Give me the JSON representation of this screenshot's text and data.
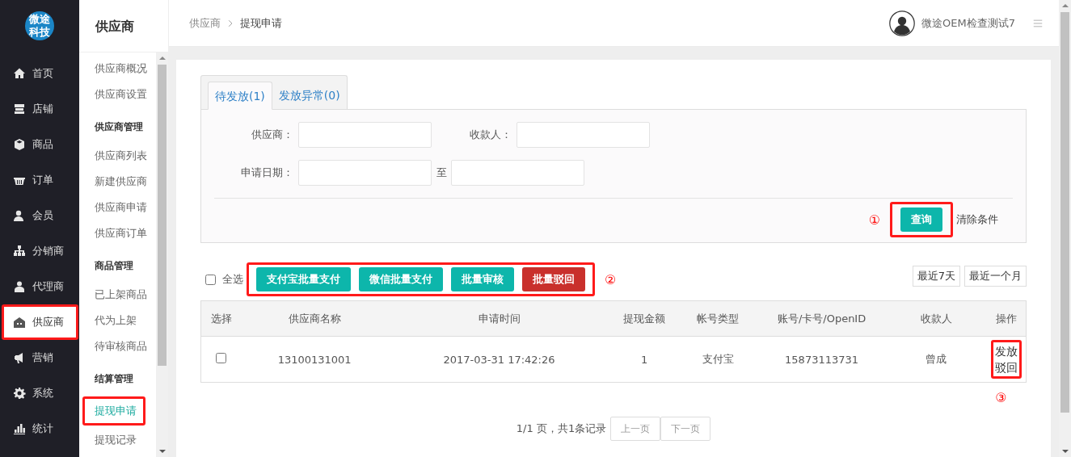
{
  "nav": {
    "logo": "微途科技",
    "items": [
      {
        "label": "首页",
        "selected": false,
        "highlighted": false
      },
      {
        "label": "店铺",
        "selected": false,
        "highlighted": false
      },
      {
        "label": "商品",
        "selected": false,
        "highlighted": false
      },
      {
        "label": "订单",
        "selected": false,
        "highlighted": false
      },
      {
        "label": "会员",
        "selected": false,
        "highlighted": false
      },
      {
        "label": "分销商",
        "selected": false,
        "highlighted": false
      },
      {
        "label": "代理商",
        "selected": false,
        "highlighted": false
      },
      {
        "label": "供应商",
        "selected": true,
        "highlighted": true
      },
      {
        "label": "营销",
        "selected": false,
        "highlighted": false
      },
      {
        "label": "系统",
        "selected": false,
        "highlighted": false
      },
      {
        "label": "统计",
        "selected": false,
        "highlighted": false
      }
    ]
  },
  "subnav": {
    "title": "供应商",
    "groups": [
      {
        "items": [
          {
            "label": "供应商概况",
            "selected": false,
            "highlighted": false
          },
          {
            "label": "供应商设置",
            "selected": false,
            "highlighted": false
          }
        ]
      },
      {
        "title": "供应商管理",
        "items": [
          {
            "label": "供应商列表",
            "selected": false,
            "highlighted": false
          },
          {
            "label": "新建供应商",
            "selected": false,
            "highlighted": false
          },
          {
            "label": "供应商申请",
            "selected": false,
            "highlighted": false
          },
          {
            "label": "供应商订单",
            "selected": false,
            "highlighted": false
          }
        ]
      },
      {
        "title": "商品管理",
        "items": [
          {
            "label": "已上架商品",
            "selected": false,
            "highlighted": false
          },
          {
            "label": "代为上架",
            "selected": false,
            "highlighted": false
          },
          {
            "label": "待审核商品",
            "selected": false,
            "highlighted": false
          }
        ]
      },
      {
        "title": "结算管理",
        "items": [
          {
            "label": "提现申请",
            "selected": true,
            "highlighted": true
          },
          {
            "label": "提现记录",
            "selected": false,
            "highlighted": false
          }
        ]
      }
    ]
  },
  "header": {
    "breadcrumb": [
      "供应商",
      "提现申请"
    ],
    "user": "微途OEM检查测试7"
  },
  "tabs": [
    {
      "label": "待发放(1)",
      "selected": true
    },
    {
      "label": "发放异常(0)",
      "selected": false
    }
  ],
  "filters": {
    "rows": [
      [
        {
          "label": "供应商："
        },
        {
          "label": "收款人："
        }
      ],
      [
        {
          "label": "申请日期：",
          "range_separator": "至"
        }
      ]
    ]
  },
  "query_button": {
    "label": "查询",
    "highlighted": true,
    "marker": "①"
  },
  "clear_link": "清除条件",
  "select_all": {
    "label": "全选",
    "checked": false
  },
  "batch_actions": {
    "highlighted": true,
    "marker": "②",
    "buttons": [
      {
        "label": "支付宝批量支付",
        "kind": "primary"
      },
      {
        "label": "微信批量支付",
        "kind": "primary"
      },
      {
        "label": "批量审核",
        "kind": "primary"
      },
      {
        "label": "批量驳回",
        "kind": "danger"
      }
    ]
  },
  "quick_ranges": [
    "最近7天",
    "最近一个月"
  ],
  "table": {
    "columns": [
      "选择",
      "供应商名称",
      "申请时间",
      "提现金额",
      "帐号类型",
      "账号/卡号/OpenID",
      "收款人",
      "操作"
    ],
    "rows": [
      {
        "cells": [
          {
            "kind": "checkbox",
            "checked": false
          },
          {
            "kind": "text",
            "text": "13100131001"
          },
          {
            "kind": "text",
            "text": "2017-03-31 17:42:26"
          },
          {
            "kind": "text",
            "text": "1"
          },
          {
            "kind": "text",
            "text": "支付宝"
          },
          {
            "kind": "text",
            "text": "15873113731"
          },
          {
            "kind": "text",
            "text": "曾成"
          },
          {
            "kind": "actions",
            "highlighted": true,
            "marker": "③",
            "links": [
              "发放",
              "驳回"
            ]
          }
        ]
      }
    ]
  },
  "pagination": {
    "summary": "1/1 页，共1条记录",
    "prev": "上一页",
    "next": "下一页"
  }
}
